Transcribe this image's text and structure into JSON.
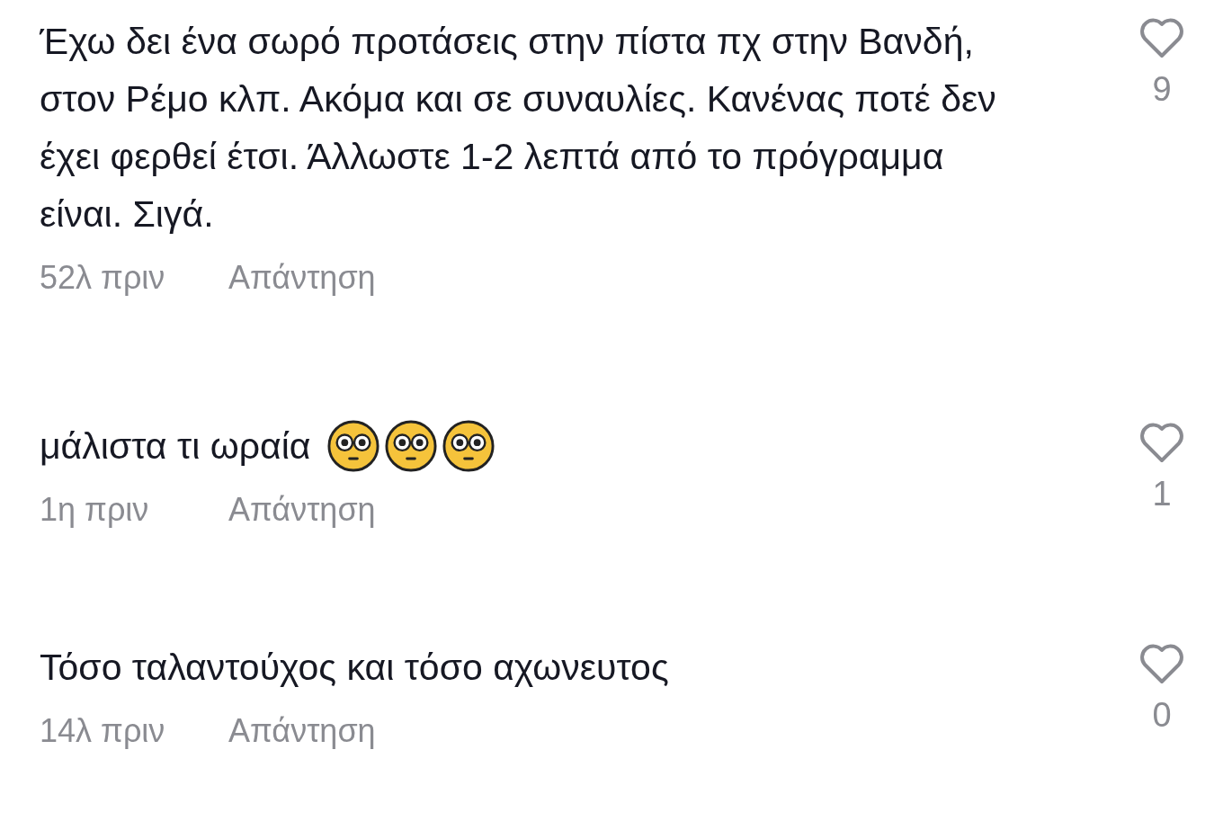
{
  "comments": [
    {
      "text": "Έχω δει ένα σωρό προτάσεις στην πίστα πχ στην Βανδή, στον Ρέμο κλπ. Ακόμα και σε συναυλίες. Κανένας ποτέ δεν έχει φερθεί έτσι. Άλλωστε 1-2 λεπτά από το πρόγραμμα είναι. Σιγά.",
      "time": "52λ πριν",
      "reply": "Απάντηση",
      "likes": "9"
    },
    {
      "text": "μάλιστα τι ωραία",
      "emojis": [
        {
          "kind": "flushed"
        },
        {
          "kind": "flushed"
        },
        {
          "kind": "flushed"
        }
      ],
      "time": "1η πριν",
      "reply": "Απάντηση",
      "likes": "1"
    },
    {
      "text": "Τόσο ταλαντούχος και τόσο αχωνευτος",
      "time": "14λ πριν",
      "reply": "Απάντηση",
      "likes": "0"
    }
  ]
}
